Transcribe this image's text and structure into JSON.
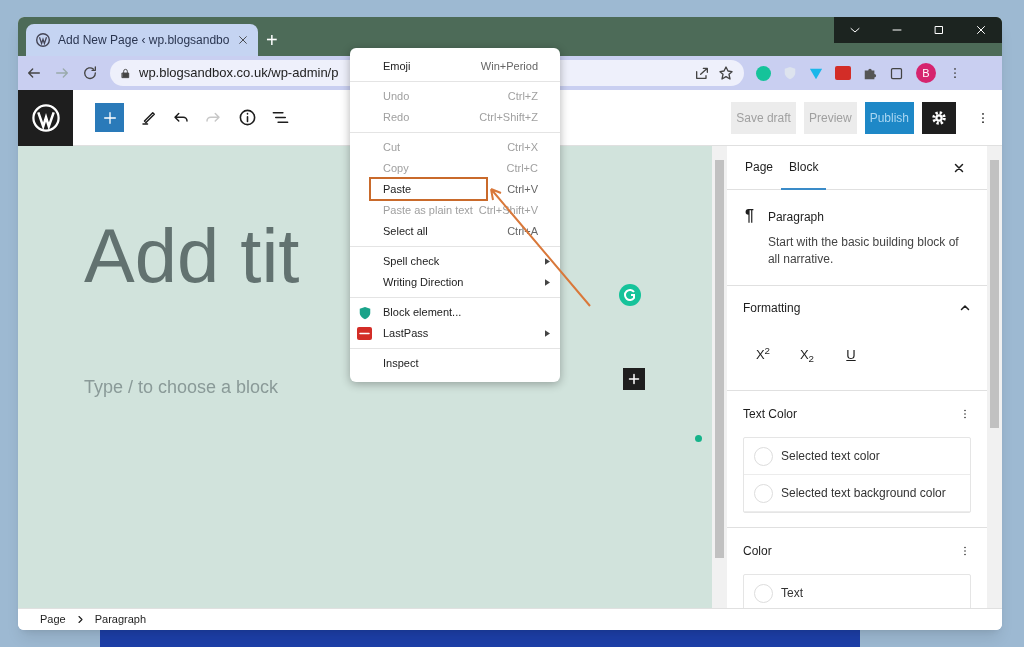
{
  "browser": {
    "tab": {
      "title": "Add New Page ‹ wp.blogsandbo"
    },
    "new_tab": "+",
    "address": "wp.blogsandbox.co.uk/wp-admin/p",
    "profile": "B"
  },
  "toolbar": {
    "buttons": [
      {
        "label": "Save draft",
        "kind": "secondary"
      },
      {
        "label": "Preview",
        "kind": "secondary"
      },
      {
        "label": "Publish",
        "kind": "primary"
      }
    ]
  },
  "editor": {
    "title_placeholder": "Add tit",
    "block_placeholder": "Type / to choose a block"
  },
  "context_menu": {
    "groups": [
      [
        {
          "label": "Emoji",
          "shortcut": "Win+Period",
          "disabled": false,
          "submenu": false,
          "highlighted": false
        }
      ],
      [
        {
          "label": "Undo",
          "shortcut": "Ctrl+Z",
          "disabled": true,
          "submenu": false,
          "highlighted": false
        },
        {
          "label": "Redo",
          "shortcut": "Ctrl+Shift+Z",
          "disabled": true,
          "submenu": false,
          "highlighted": false
        }
      ],
      [
        {
          "label": "Cut",
          "shortcut": "Ctrl+X",
          "disabled": true,
          "submenu": false,
          "highlighted": false
        },
        {
          "label": "Copy",
          "shortcut": "Ctrl+C",
          "disabled": true,
          "submenu": false,
          "highlighted": false
        },
        {
          "label": "Paste",
          "shortcut": "Ctrl+V",
          "disabled": false,
          "submenu": false,
          "highlighted": true
        },
        {
          "label": "Paste as plain text",
          "shortcut": "Ctrl+Shift+V",
          "disabled": true,
          "submenu": false,
          "highlighted": false
        },
        {
          "label": "Select all",
          "shortcut": "Ctrl+A",
          "disabled": false,
          "submenu": false,
          "highlighted": false
        }
      ],
      [
        {
          "label": "Spell check",
          "disabled": false,
          "submenu": true,
          "highlighted": false
        },
        {
          "label": "Writing Direction",
          "disabled": false,
          "submenu": true,
          "highlighted": false
        }
      ],
      [
        {
          "label": "Block element...",
          "disabled": false,
          "submenu": false,
          "highlighted": false,
          "kind": "blocker"
        },
        {
          "label": "LastPass",
          "disabled": false,
          "submenu": true,
          "highlighted": false,
          "kind": "password"
        }
      ],
      [
        {
          "label": "Inspect",
          "disabled": false,
          "submenu": false,
          "highlighted": false
        }
      ]
    ]
  },
  "sidebar": {
    "tabs": [
      {
        "label": "Page",
        "selected": false
      },
      {
        "label": "Block",
        "selected": true
      }
    ],
    "block": {
      "icon": "¶",
      "name": "Paragraph",
      "description": "Start with the basic building block of all narrative."
    },
    "formatting": {
      "title": "Formatting",
      "expanded": true,
      "buttons": [
        {
          "label": "X$^{2}$",
          "kind": "superscript"
        },
        {
          "label": "X$_{2}$",
          "kind": "subscript"
        },
        {
          "label": "U",
          "kind": "underline"
        }
      ]
    },
    "text_color": {
      "title": "Text Color",
      "options": [
        "Selected text color",
        "Selected text background color"
      ]
    },
    "color": {
      "title": "Color",
      "options": [
        "Text"
      ]
    }
  },
  "breadcrumbs": [
    "Page",
    "Paragraph"
  ]
}
